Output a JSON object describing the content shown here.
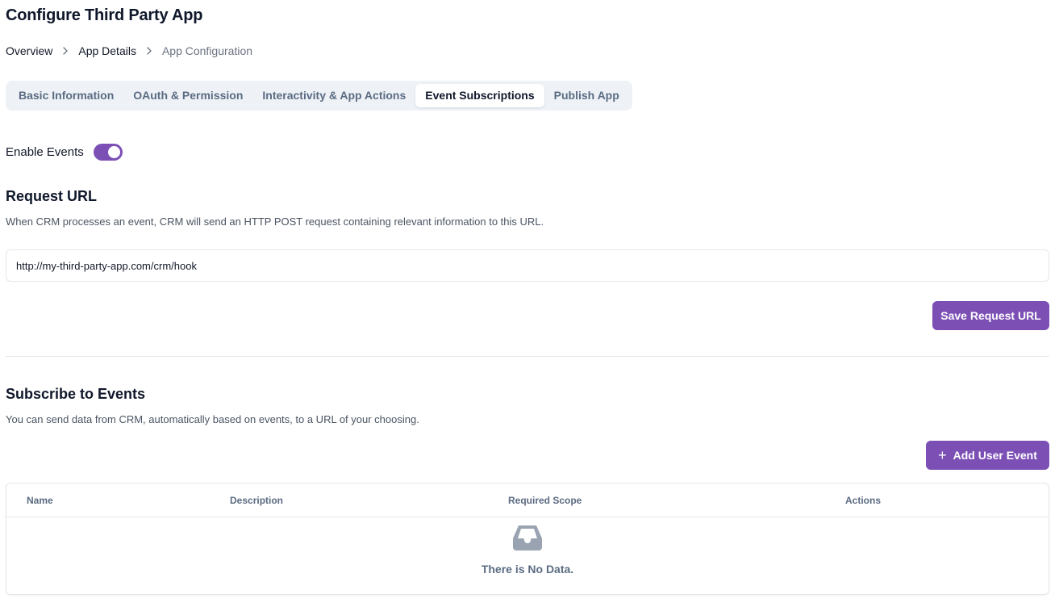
{
  "page": {
    "title": "Configure Third Party App"
  },
  "breadcrumb": [
    {
      "label": "Overview"
    },
    {
      "label": "App Details"
    },
    {
      "label": "App Configuration"
    }
  ],
  "tabs": [
    {
      "label": "Basic Information",
      "active": false
    },
    {
      "label": "OAuth & Permission",
      "active": false
    },
    {
      "label": "Interactivity & App Actions",
      "active": false
    },
    {
      "label": "Event Subscriptions",
      "active": true
    },
    {
      "label": "Publish App",
      "active": false
    }
  ],
  "events_toggle": {
    "label": "Enable Events",
    "enabled": true
  },
  "request_url": {
    "title": "Request URL",
    "description": "When CRM processes an event, CRM will send an HTTP POST request containing relevant information to this URL.",
    "value": "http://my-third-party-app.com/crm/hook",
    "save_label": "Save Request URL"
  },
  "subscribe": {
    "title": "Subscribe to Events",
    "description": "You can send data from CRM, automatically based on events, to a URL of your choosing.",
    "add_label": "Add User Event",
    "columns": [
      "Name",
      "Description",
      "Required Scope",
      "Actions"
    ],
    "empty_text": "There is No Data."
  },
  "colors": {
    "accent": "#7c4fb5",
    "tab_bg": "#eef2f7",
    "muted": "#5b6b82"
  },
  "icons": {
    "breadcrumb_separator": "chevron-right-icon",
    "empty": "inbox-icon",
    "add": "plus-icon"
  }
}
